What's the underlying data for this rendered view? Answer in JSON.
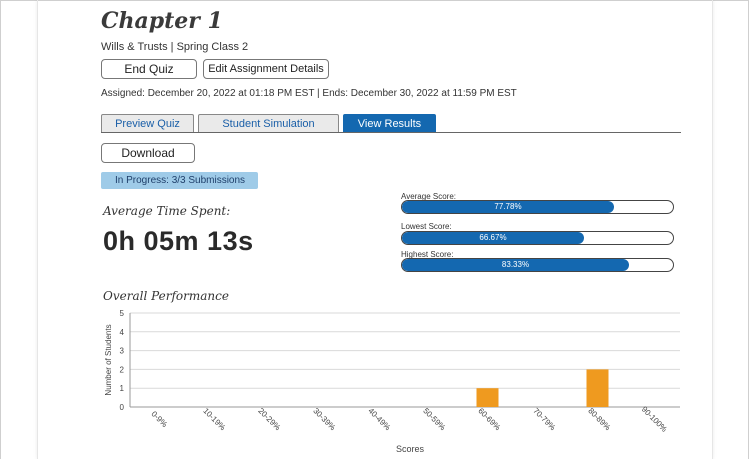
{
  "header": {
    "title": "Chapter 1",
    "subtitle": "Wills & Trusts | Spring Class 2",
    "end_quiz_label": "End Quiz",
    "edit_details_label": "Edit Assignment Details",
    "assigned_text": "Assigned: December 20, 2022 at 01:18 PM EST  |  Ends: December 30, 2022 at 11:59 PM EST"
  },
  "tabs": [
    {
      "label": "Preview Quiz",
      "active": false
    },
    {
      "label": "Student Simulation",
      "active": false
    },
    {
      "label": "View Results",
      "active": true
    }
  ],
  "download_label": "Download",
  "status_badge": "In Progress: 3/3 Submissions",
  "average_time": {
    "label": "Average Time Spent:",
    "value": "0h 05m 13s"
  },
  "scores": [
    {
      "label": "Average Score:",
      "value_text": "77.78%",
      "percent": 77.78
    },
    {
      "label": "Lowest Score:",
      "value_text": "66.67%",
      "percent": 66.67
    },
    {
      "label": "Highest Score:",
      "value_text": "83.33%",
      "percent": 83.33
    }
  ],
  "colors": {
    "accent": "#1468b0",
    "bar": "#ef9a1f",
    "badge_bg": "#9fcbe8"
  },
  "performance_title": "Overall Performance",
  "chart_data": {
    "type": "bar",
    "categories": [
      "0-9%",
      "10-19%",
      "20-29%",
      "30-39%",
      "40-49%",
      "50-59%",
      "60-69%",
      "70-79%",
      "80-89%",
      "90-100%"
    ],
    "values": [
      0,
      0,
      0,
      0,
      0,
      0,
      1,
      0,
      2,
      0
    ],
    "xlabel": "Scores",
    "ylabel": "Number of Students",
    "ylim": [
      0,
      5
    ],
    "yticks": [
      0,
      1,
      2,
      3,
      4,
      5
    ],
    "grid": true
  }
}
